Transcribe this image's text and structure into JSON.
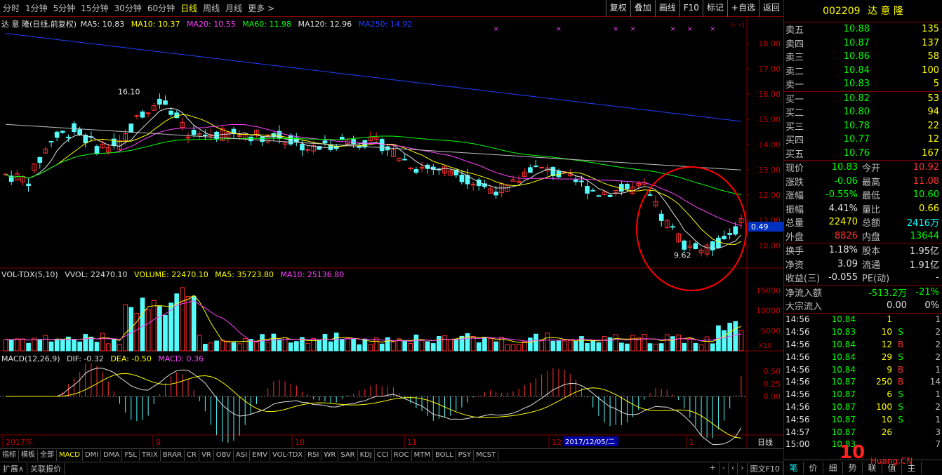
{
  "toolbar": {
    "periods": [
      "分时",
      "1分钟",
      "5分钟",
      "15分钟",
      "30分钟",
      "60分钟",
      "日线",
      "周线",
      "月线",
      "更多 >"
    ],
    "active_period": "日线",
    "actions": [
      "复权",
      "叠加",
      "画线",
      "F10",
      "标记",
      "+自选",
      "返回"
    ]
  },
  "main_legend": {
    "name": "达 意 隆(日线,前复权)",
    "ma5": "MA5: 10.83",
    "ma10": "MA10: 10.37",
    "ma20": "MA20: 10.55",
    "ma60": "MA60: 11.98",
    "ma120": "MA120: 12.96",
    "ma250": "MA250: 14.92"
  },
  "vol_legend": {
    "name": "VOL-TDX(5,10)",
    "vvol": "VVOL: 22470.10",
    "volume": "VOLUME: 22470.10",
    "ma5": "MA5: 35723.80",
    "ma10": "MA10: 25136.80"
  },
  "macd_legend": {
    "name": "MACD(12,26,9)",
    "dif": "DIF: -0.32",
    "dea": "DEA: -0.50",
    "macd": "MACD: 0.36"
  },
  "price_axis": [
    "18.00",
    "17.00",
    "16.00",
    "15.00",
    "14.00",
    "13.00",
    "12.00",
    "11.00",
    "10.00"
  ],
  "vol_axis": [
    "15000",
    "10000",
    "5000"
  ],
  "vol_unit": "X10",
  "macd_axis": [
    "0.50",
    "0.25",
    "0.00"
  ],
  "current_tag": "0.49",
  "high_label": "16.10",
  "low_label": "9.62",
  "date_labels": [
    "2017年",
    "9",
    "10",
    "11",
    "12",
    "1"
  ],
  "cursor_date": "2017/12/05/二",
  "period_btn": "日线",
  "indicator_tabs": [
    "指标",
    "模板",
    "全部",
    "MACD",
    "DMI",
    "DMA",
    "FSL",
    "TRIX",
    "BRAR",
    "CR",
    "VR",
    "OBV",
    "ASI",
    "EMV",
    "VOL-TDX",
    "RSI",
    "WR",
    "SAR",
    "KDJ",
    "CCI",
    "ROC",
    "MTM",
    "BOLL",
    "PSY",
    "MCST"
  ],
  "active_indicator": "MACD",
  "bottom_tabs": [
    "扩展∧",
    "关联报价"
  ],
  "bottom_right": [
    "+",
    "-",
    "‹",
    "›",
    "图文F10"
  ],
  "colors": {
    "up": "#ff3030",
    "down": "#54fcfc",
    "ma5": "#e0e0e0",
    "ma10": "#ffff00",
    "ma20": "#ff40ff",
    "ma60": "#00ff00",
    "ma120": "#c0c0c0",
    "ma250": "#2040ff",
    "circle": "#ff0000"
  },
  "panel": {
    "code": "002209",
    "name": "达 意 隆",
    "asks": [
      {
        "label": "卖五",
        "price": "10.88",
        "vol": "135"
      },
      {
        "label": "卖四",
        "price": "10.87",
        "vol": "137"
      },
      {
        "label": "卖三",
        "price": "10.86",
        "vol": "58"
      },
      {
        "label": "卖二",
        "price": "10.84",
        "vol": "100"
      },
      {
        "label": "卖一",
        "price": "10.83",
        "vol": "5"
      }
    ],
    "bids": [
      {
        "label": "买一",
        "price": "10.82",
        "vol": "53"
      },
      {
        "label": "买二",
        "price": "10.80",
        "vol": "94"
      },
      {
        "label": "买三",
        "price": "10.78",
        "vol": "22"
      },
      {
        "label": "买四",
        "price": "10.77",
        "vol": "12"
      },
      {
        "label": "买五",
        "price": "10.76",
        "vol": "167"
      }
    ],
    "quote": [
      {
        "l1": "现价",
        "v1": "10.83",
        "c1": "g",
        "l2": "今开",
        "v2": "10.92",
        "c2": "r"
      },
      {
        "l1": "涨跌",
        "v1": "-0.06",
        "c1": "g",
        "l2": "最高",
        "v2": "11.08",
        "c2": "r"
      },
      {
        "l1": "涨幅",
        "v1": "-0.55%",
        "c1": "g",
        "l2": "最低",
        "v2": "10.60",
        "c2": "g"
      },
      {
        "l1": "振幅",
        "v1": "4.41%",
        "c1": "w",
        "l2": "量比",
        "v2": "0.66",
        "c2": "y"
      },
      {
        "l1": "总量",
        "v1": "22470",
        "c1": "y",
        "l2": "总额",
        "v2": "2416万",
        "c2": "c"
      },
      {
        "l1": "外盘",
        "v1": "8826",
        "c1": "r",
        "l2": "内盘",
        "v2": "13644",
        "c2": "g"
      }
    ],
    "fund": [
      {
        "l1": "换手",
        "v1": "1.18%",
        "l2": "股本",
        "v2": "1.95亿"
      },
      {
        "l1": "净资",
        "v1": "3.09",
        "l2": "流通",
        "v2": "1.91亿"
      },
      {
        "l1": "收益(三)",
        "v1": "-0.055",
        "l2": "PE(动)",
        "v2": "-"
      }
    ],
    "flow": [
      {
        "label": "净流入额",
        "v1": "-513.2万",
        "v2": "-21%"
      },
      {
        "label": "大宗流入",
        "v1": "0.00",
        "v2": "0%"
      }
    ],
    "ticks": [
      {
        "t": "14:56",
        "p": "10.84",
        "v": "1",
        "bs": "",
        "n": "1"
      },
      {
        "t": "14:56",
        "p": "10.83",
        "v": "10",
        "bs": "S",
        "n": "2"
      },
      {
        "t": "14:56",
        "p": "10.84",
        "v": "12",
        "bs": "B",
        "n": "2"
      },
      {
        "t": "14:56",
        "p": "10.84",
        "v": "29",
        "bs": "S",
        "n": "2"
      },
      {
        "t": "14:56",
        "p": "10.84",
        "v": "9",
        "bs": "B",
        "n": "1"
      },
      {
        "t": "14:56",
        "p": "10.87",
        "v": "250",
        "bs": "B",
        "n": "14"
      },
      {
        "t": "14:56",
        "p": "10.87",
        "v": "6",
        "bs": "S",
        "n": "1"
      },
      {
        "t": "14:56",
        "p": "10.87",
        "v": "100",
        "bs": "S",
        "n": "2"
      },
      {
        "t": "14:56",
        "p": "10.87",
        "v": "10",
        "bs": "S",
        "n": "1"
      },
      {
        "t": "14:57",
        "p": "10.87",
        "v": "26",
        "bs": "",
        "n": "3"
      },
      {
        "t": "15:00",
        "p": "10.83",
        "v": "",
        "bs": "",
        "n": "7"
      }
    ],
    "bottom_tabs": [
      "笔",
      "价",
      "细",
      "势",
      "联",
      "值",
      "主"
    ],
    "active_tab": "笔"
  },
  "watermark": "10",
  "watermark_site": "Huang.CN"
}
